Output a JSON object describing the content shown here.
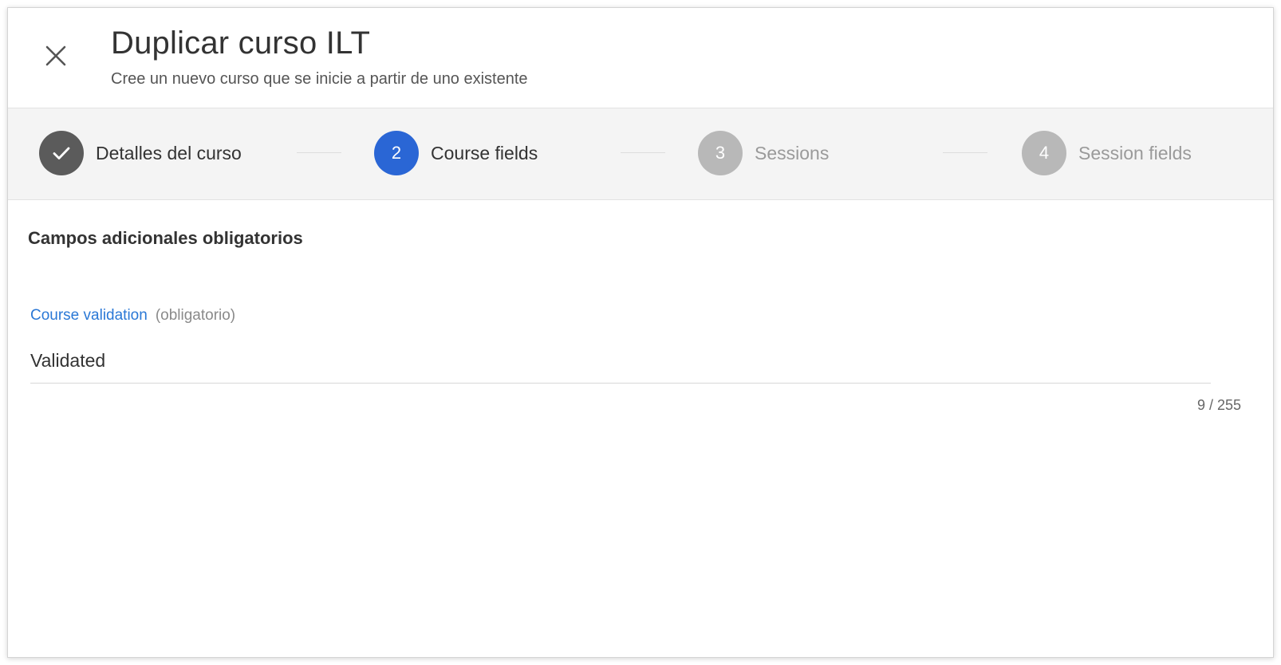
{
  "dialog": {
    "title": "Duplicar curso ILT",
    "subtitle": "Cree un nuevo curso que se inicie a partir de uno existente",
    "close_icon": "close-icon"
  },
  "stepper": {
    "steps": [
      {
        "number": "1",
        "label": "Detalles del curso",
        "state": "done",
        "icon": "check-icon"
      },
      {
        "number": "2",
        "label": "Course fields",
        "state": "active"
      },
      {
        "number": "3",
        "label": "Sessions",
        "state": "pending"
      },
      {
        "number": "4",
        "label": "Session fields",
        "state": "pending"
      }
    ]
  },
  "content": {
    "section_title": "Campos adicionales obligatorios",
    "field": {
      "label": "Course validation",
      "required_note": "(obligatorio)",
      "value": "Validated",
      "counter": "9 / 255"
    }
  },
  "colors": {
    "active": "#2a66d5",
    "done": "#5b5b5b",
    "pending": "#b8b8b8",
    "link": "#2a78d6"
  }
}
